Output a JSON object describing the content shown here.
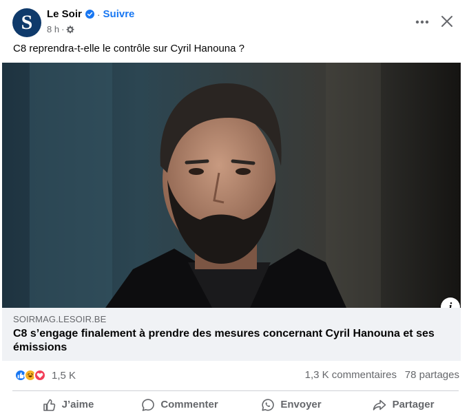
{
  "post": {
    "page_name": "Le Soir",
    "avatar_letter": "S",
    "follow_label": "Suivre",
    "time": "8 h",
    "text": "C8 reprendra-t-elle le contrôle sur Cyril Hanouna ?"
  },
  "link_preview": {
    "domain": "SOIRMAG.LESOIR.BE",
    "title": "C8 s’engage finalement à prendre des mesures concernant Cyril Hanouna et ses émissions",
    "info_glyph": "i"
  },
  "stats": {
    "reactions_count": "1,5 K",
    "comments": "1,3 K commentaires",
    "shares": "78 partages"
  },
  "actions": {
    "like": "J’aime",
    "comment": "Commenter",
    "send": "Envoyer",
    "share": "Partager"
  },
  "icons": {
    "verified": "verified-badge-icon",
    "audience": "gear-icon",
    "more": "more-options-icon",
    "close": "close-icon",
    "info": "info-icon",
    "like": "thumbs-up-icon",
    "comment": "speech-bubble-icon",
    "send": "whatsapp-icon",
    "share": "share-arrow-icon"
  },
  "colors": {
    "brand_blue": "#1877f2",
    "avatar_bg": "#0f3a6b",
    "secondary_text": "#65676b",
    "link_bg": "#f0f2f5",
    "love": "#f33e58",
    "haha": "#f7b125"
  }
}
